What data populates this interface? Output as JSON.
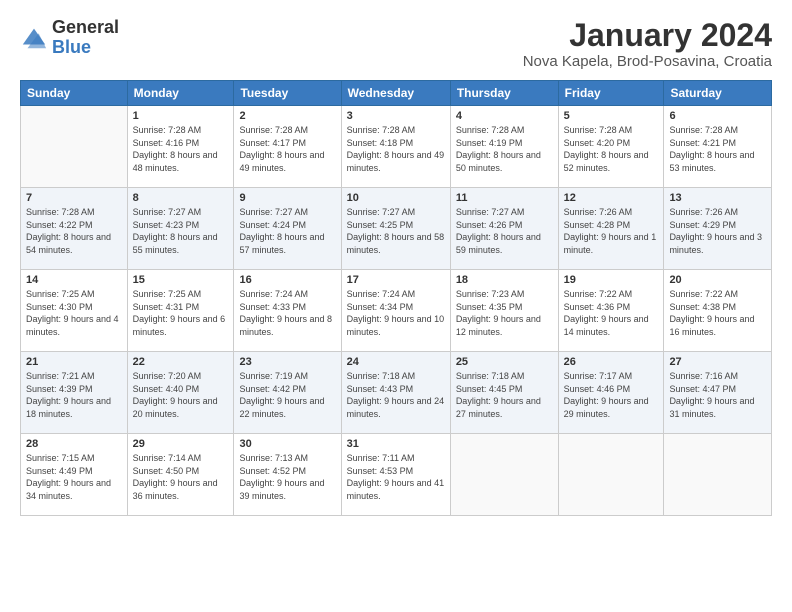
{
  "header": {
    "logo_general": "General",
    "logo_blue": "Blue",
    "title": "January 2024",
    "subtitle": "Nova Kapela, Brod-Posavina, Croatia"
  },
  "days_of_week": [
    "Sunday",
    "Monday",
    "Tuesday",
    "Wednesday",
    "Thursday",
    "Friday",
    "Saturday"
  ],
  "weeks": [
    [
      {
        "day": "",
        "sunrise": "",
        "sunset": "",
        "daylight": ""
      },
      {
        "day": "1",
        "sunrise": "Sunrise: 7:28 AM",
        "sunset": "Sunset: 4:16 PM",
        "daylight": "Daylight: 8 hours and 48 minutes."
      },
      {
        "day": "2",
        "sunrise": "Sunrise: 7:28 AM",
        "sunset": "Sunset: 4:17 PM",
        "daylight": "Daylight: 8 hours and 49 minutes."
      },
      {
        "day": "3",
        "sunrise": "Sunrise: 7:28 AM",
        "sunset": "Sunset: 4:18 PM",
        "daylight": "Daylight: 8 hours and 49 minutes."
      },
      {
        "day": "4",
        "sunrise": "Sunrise: 7:28 AM",
        "sunset": "Sunset: 4:19 PM",
        "daylight": "Daylight: 8 hours and 50 minutes."
      },
      {
        "day": "5",
        "sunrise": "Sunrise: 7:28 AM",
        "sunset": "Sunset: 4:20 PM",
        "daylight": "Daylight: 8 hours and 52 minutes."
      },
      {
        "day": "6",
        "sunrise": "Sunrise: 7:28 AM",
        "sunset": "Sunset: 4:21 PM",
        "daylight": "Daylight: 8 hours and 53 minutes."
      }
    ],
    [
      {
        "day": "7",
        "sunrise": "Sunrise: 7:28 AM",
        "sunset": "Sunset: 4:22 PM",
        "daylight": "Daylight: 8 hours and 54 minutes."
      },
      {
        "day": "8",
        "sunrise": "Sunrise: 7:27 AM",
        "sunset": "Sunset: 4:23 PM",
        "daylight": "Daylight: 8 hours and 55 minutes."
      },
      {
        "day": "9",
        "sunrise": "Sunrise: 7:27 AM",
        "sunset": "Sunset: 4:24 PM",
        "daylight": "Daylight: 8 hours and 57 minutes."
      },
      {
        "day": "10",
        "sunrise": "Sunrise: 7:27 AM",
        "sunset": "Sunset: 4:25 PM",
        "daylight": "Daylight: 8 hours and 58 minutes."
      },
      {
        "day": "11",
        "sunrise": "Sunrise: 7:27 AM",
        "sunset": "Sunset: 4:26 PM",
        "daylight": "Daylight: 8 hours and 59 minutes."
      },
      {
        "day": "12",
        "sunrise": "Sunrise: 7:26 AM",
        "sunset": "Sunset: 4:28 PM",
        "daylight": "Daylight: 9 hours and 1 minute."
      },
      {
        "day": "13",
        "sunrise": "Sunrise: 7:26 AM",
        "sunset": "Sunset: 4:29 PM",
        "daylight": "Daylight: 9 hours and 3 minutes."
      }
    ],
    [
      {
        "day": "14",
        "sunrise": "Sunrise: 7:25 AM",
        "sunset": "Sunset: 4:30 PM",
        "daylight": "Daylight: 9 hours and 4 minutes."
      },
      {
        "day": "15",
        "sunrise": "Sunrise: 7:25 AM",
        "sunset": "Sunset: 4:31 PM",
        "daylight": "Daylight: 9 hours and 6 minutes."
      },
      {
        "day": "16",
        "sunrise": "Sunrise: 7:24 AM",
        "sunset": "Sunset: 4:33 PM",
        "daylight": "Daylight: 9 hours and 8 minutes."
      },
      {
        "day": "17",
        "sunrise": "Sunrise: 7:24 AM",
        "sunset": "Sunset: 4:34 PM",
        "daylight": "Daylight: 9 hours and 10 minutes."
      },
      {
        "day": "18",
        "sunrise": "Sunrise: 7:23 AM",
        "sunset": "Sunset: 4:35 PM",
        "daylight": "Daylight: 9 hours and 12 minutes."
      },
      {
        "day": "19",
        "sunrise": "Sunrise: 7:22 AM",
        "sunset": "Sunset: 4:36 PM",
        "daylight": "Daylight: 9 hours and 14 minutes."
      },
      {
        "day": "20",
        "sunrise": "Sunrise: 7:22 AM",
        "sunset": "Sunset: 4:38 PM",
        "daylight": "Daylight: 9 hours and 16 minutes."
      }
    ],
    [
      {
        "day": "21",
        "sunrise": "Sunrise: 7:21 AM",
        "sunset": "Sunset: 4:39 PM",
        "daylight": "Daylight: 9 hours and 18 minutes."
      },
      {
        "day": "22",
        "sunrise": "Sunrise: 7:20 AM",
        "sunset": "Sunset: 4:40 PM",
        "daylight": "Daylight: 9 hours and 20 minutes."
      },
      {
        "day": "23",
        "sunrise": "Sunrise: 7:19 AM",
        "sunset": "Sunset: 4:42 PM",
        "daylight": "Daylight: 9 hours and 22 minutes."
      },
      {
        "day": "24",
        "sunrise": "Sunrise: 7:18 AM",
        "sunset": "Sunset: 4:43 PM",
        "daylight": "Daylight: 9 hours and 24 minutes."
      },
      {
        "day": "25",
        "sunrise": "Sunrise: 7:18 AM",
        "sunset": "Sunset: 4:45 PM",
        "daylight": "Daylight: 9 hours and 27 minutes."
      },
      {
        "day": "26",
        "sunrise": "Sunrise: 7:17 AM",
        "sunset": "Sunset: 4:46 PM",
        "daylight": "Daylight: 9 hours and 29 minutes."
      },
      {
        "day": "27",
        "sunrise": "Sunrise: 7:16 AM",
        "sunset": "Sunset: 4:47 PM",
        "daylight": "Daylight: 9 hours and 31 minutes."
      }
    ],
    [
      {
        "day": "28",
        "sunrise": "Sunrise: 7:15 AM",
        "sunset": "Sunset: 4:49 PM",
        "daylight": "Daylight: 9 hours and 34 minutes."
      },
      {
        "day": "29",
        "sunrise": "Sunrise: 7:14 AM",
        "sunset": "Sunset: 4:50 PM",
        "daylight": "Daylight: 9 hours and 36 minutes."
      },
      {
        "day": "30",
        "sunrise": "Sunrise: 7:13 AM",
        "sunset": "Sunset: 4:52 PM",
        "daylight": "Daylight: 9 hours and 39 minutes."
      },
      {
        "day": "31",
        "sunrise": "Sunrise: 7:11 AM",
        "sunset": "Sunset: 4:53 PM",
        "daylight": "Daylight: 9 hours and 41 minutes."
      },
      {
        "day": "",
        "sunrise": "",
        "sunset": "",
        "daylight": ""
      },
      {
        "day": "",
        "sunrise": "",
        "sunset": "",
        "daylight": ""
      },
      {
        "day": "",
        "sunrise": "",
        "sunset": "",
        "daylight": ""
      }
    ]
  ]
}
